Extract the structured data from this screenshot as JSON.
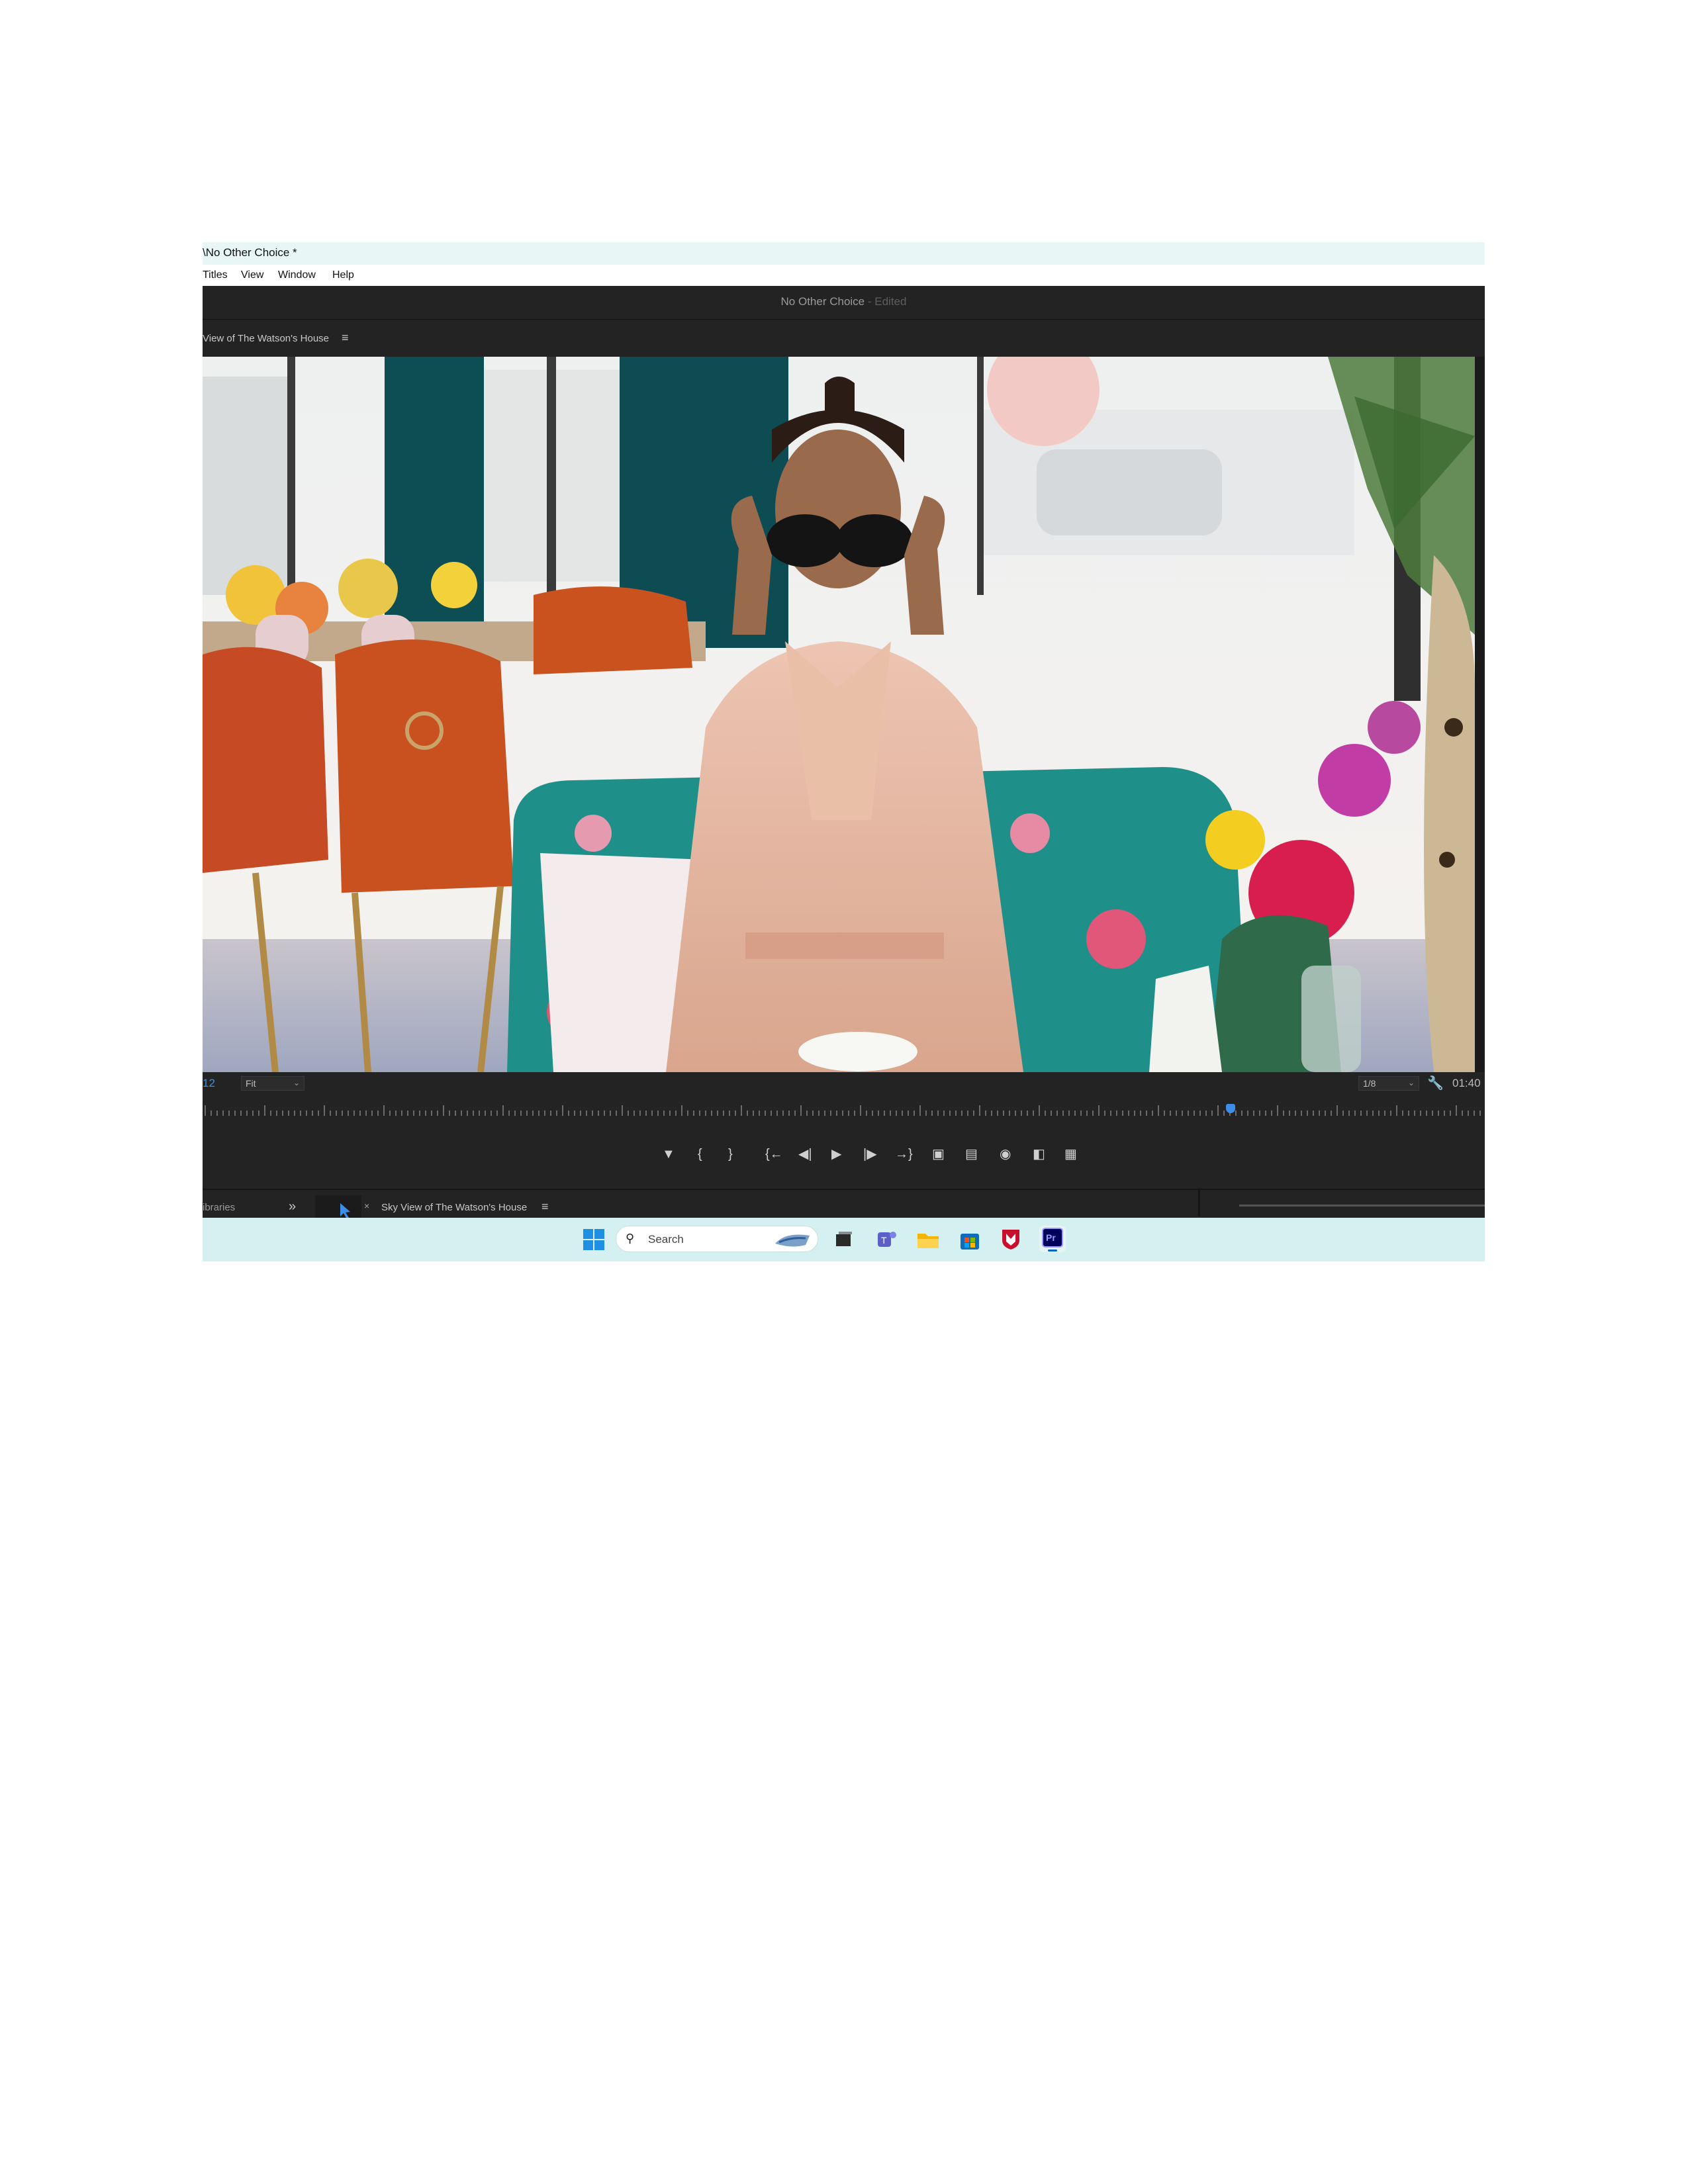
{
  "window": {
    "title": "\\No Other Choice *"
  },
  "menu": {
    "items": [
      "Titles",
      "View",
      "Window",
      "Help"
    ]
  },
  "app_header": {
    "project_title": "No Other Choice",
    "edited_suffix": "- Edited"
  },
  "source_panel": {
    "tab_label": "View of The Watson's House",
    "menu_icon": "hamburger-menu-icon"
  },
  "controls": {
    "timecode_left": "12",
    "fit_value": "Fit",
    "resolution_value": "1/8",
    "timecode_right": "01:40",
    "wrench_icon": "wrench-icon"
  },
  "transport": {
    "icons": [
      "add-marker-icon",
      "mark-in-icon",
      "mark-out-icon",
      "go-to-in-icon",
      "step-back-icon",
      "play-icon",
      "step-forward-icon",
      "go-to-out-icon",
      "insert-icon",
      "overwrite-icon",
      "export-frame-icon",
      "comparison-view-icon",
      "button-editor-icon"
    ]
  },
  "bottom_panel": {
    "libraries_tab": "ibraries",
    "more_icon": "chevron-double-right-icon",
    "sequence_close": "×",
    "sequence_tab": "Sky View of The Watson's House"
  },
  "taskbar": {
    "search_placeholder": "Search",
    "icons": [
      "windows-start-icon",
      "search-icon",
      "widget-icon",
      "task-view-icon",
      "teams-icon",
      "file-explorer-icon",
      "store-icon",
      "mcafee-icon",
      "premiere-pro-icon"
    ],
    "premiere_label": "Pr"
  },
  "colors": {
    "accent_blue": "#3a8fe8",
    "panel_bg": "#232323",
    "taskbar_bg": "#d4f0f0"
  }
}
